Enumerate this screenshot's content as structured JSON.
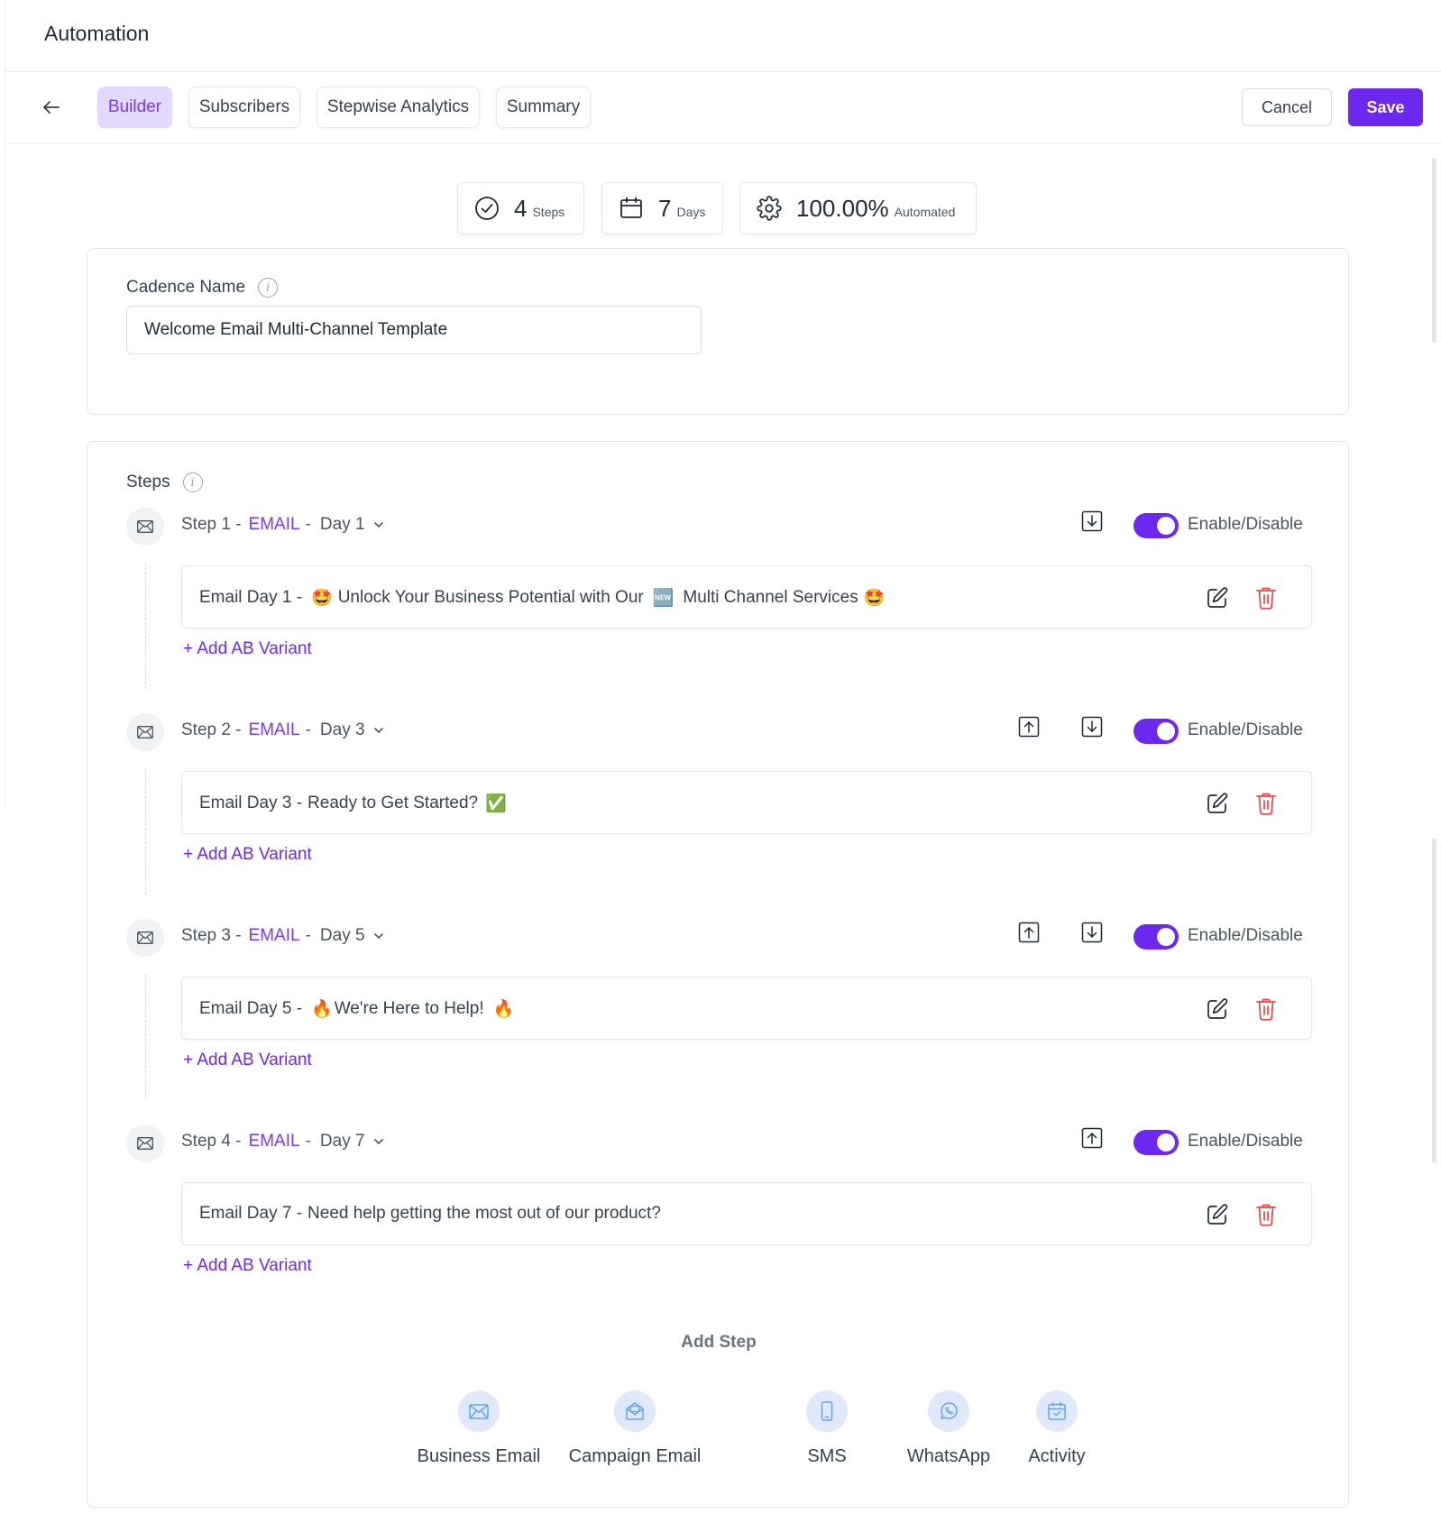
{
  "app": {
    "title": "Automation"
  },
  "nav": {
    "tabs": [
      {
        "label": "Builder",
        "active": true
      },
      {
        "label": "Subscribers",
        "active": false
      },
      {
        "label": "Stepwise Analytics",
        "active": false
      },
      {
        "label": "Summary",
        "active": false
      }
    ],
    "cancel_label": "Cancel",
    "save_label": "Save"
  },
  "stats": [
    {
      "icon": "check-circle-icon",
      "value": "4",
      "unit": "Steps"
    },
    {
      "icon": "calendar-icon",
      "value": "7",
      "unit": "Days"
    },
    {
      "icon": "gear-icon",
      "value": "100.00%",
      "unit": "Automated"
    }
  ],
  "cadence": {
    "label": "Cadence Name",
    "value": "Welcome Email Multi-Channel Template"
  },
  "steps_section": {
    "label": "Steps",
    "toggle_label": "Enable/Disable",
    "add_variant_label": "+ Add AB Variant",
    "steps": [
      {
        "step": "Step 1 -",
        "channel": "EMAIL",
        "sep": "-",
        "day": "Day 1",
        "enabled": true,
        "email_prefix": "Email Day 1 -",
        "email_parts": [
          "Unlock Your Business Potential with Our",
          "Multi Channel Services"
        ],
        "emojis": [
          "🤩",
          "🆕",
          "🤩"
        ]
      },
      {
        "step": "Step 2 -",
        "channel": "EMAIL",
        "sep": "-",
        "day": "Day 3",
        "enabled": true,
        "email_prefix": "Email Day 3 -",
        "email_parts": [
          "Ready to Get Started?"
        ],
        "emojis": [
          "✅"
        ]
      },
      {
        "step": "Step 3 -",
        "channel": "EMAIL",
        "sep": "-",
        "day": "Day 5",
        "enabled": true,
        "email_prefix": "Email Day 5 -",
        "email_parts": [
          "We're Here to Help!"
        ],
        "emojis": [
          "🔥",
          "🔥"
        ]
      },
      {
        "step": "Step 4 -",
        "channel": "EMAIL",
        "sep": "-",
        "day": "Day 7",
        "enabled": true,
        "email_prefix": "Email Day 7 -",
        "email_parts": [
          "Need help getting the most out of our product?"
        ],
        "emojis": []
      }
    ]
  },
  "add_step": {
    "title": "Add Step",
    "options": [
      {
        "label": "Business Email",
        "icon": "mail-icon"
      },
      {
        "label": "Campaign Email",
        "icon": "campaign-mail-icon"
      },
      {
        "label": "SMS",
        "icon": "phone-icon"
      },
      {
        "label": "WhatsApp",
        "icon": "whatsapp-icon"
      },
      {
        "label": "Activity",
        "icon": "calendar-check-icon"
      }
    ]
  },
  "colors": {
    "accent": "#6d28f0",
    "tab_active_bg": "#e3d9fd",
    "delete_red": "#ef4444",
    "icon_circle_bg": "#dfe9fb"
  }
}
